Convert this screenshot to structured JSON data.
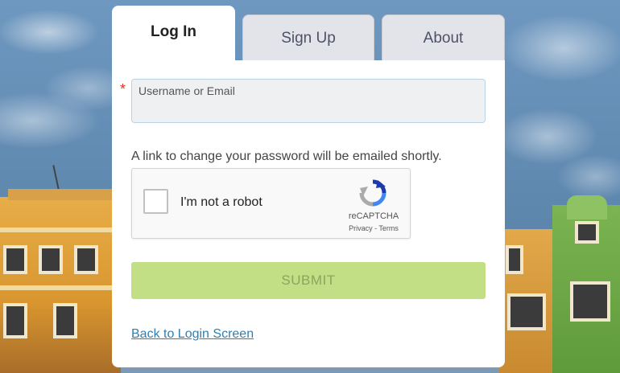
{
  "tabs": {
    "login": "Log In",
    "signup": "Sign Up",
    "about": "About"
  },
  "form": {
    "required_marker": "*",
    "username_label": "Username or Email",
    "username_value": "",
    "helper_text": "A link to change your password will be emailed shortly.",
    "submit_label": "SUBMIT",
    "back_link": "Back to Login Screen"
  },
  "captcha": {
    "checkbox_label": "I'm not a robot",
    "brand": "reCAPTCHA",
    "links": "Privacy - Terms",
    "checked": false
  },
  "colors": {
    "submit_bg": "#c3df86",
    "link": "#2f7fb3",
    "required": "#e0302a"
  }
}
